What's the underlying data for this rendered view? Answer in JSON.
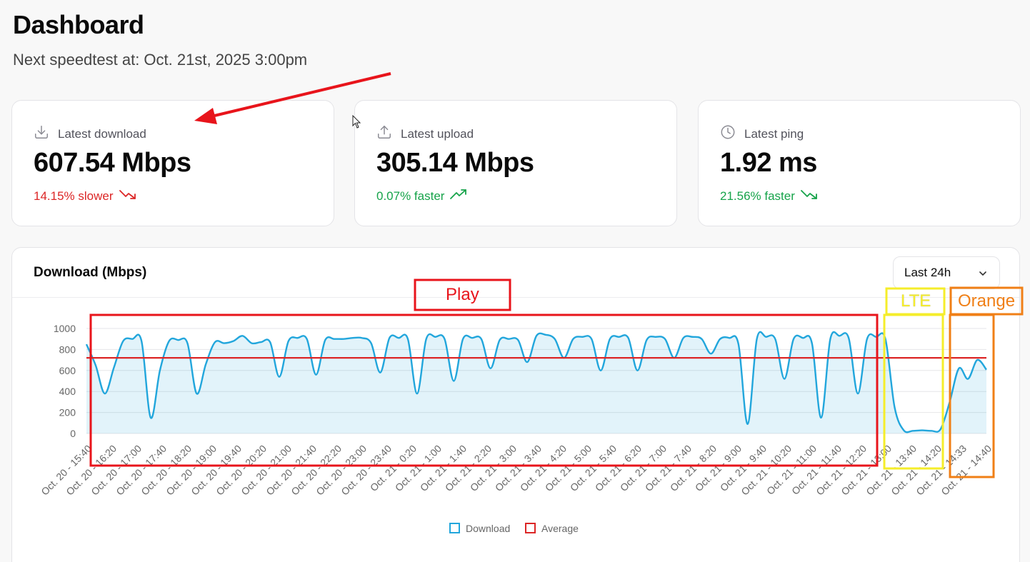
{
  "header": {
    "title": "Dashboard",
    "subtitle": "Next speedtest at: Oct. 21st, 2025 3:00pm"
  },
  "cards": [
    {
      "label": "Latest download",
      "icon": "download-icon",
      "value": "607.54 Mbps",
      "delta": "14.15% slower",
      "delta_color": "#dc2626",
      "trend": "down"
    },
    {
      "label": "Latest upload",
      "icon": "upload-icon",
      "value": "305.14 Mbps",
      "delta": "0.07% faster",
      "delta_color": "#16a34a",
      "trend": "up"
    },
    {
      "label": "Latest ping",
      "icon": "clock-icon",
      "value": "1.92 ms",
      "delta": "21.56% faster",
      "delta_color": "#16a34a",
      "trend": "down"
    }
  ],
  "chart_panel": {
    "title": "Download (Mbps)",
    "range_select": "Last 24h"
  },
  "annotations": {
    "play": "Play",
    "lte": "LTE",
    "orange": "Orange"
  },
  "chart_data": {
    "type": "area",
    "series": [
      {
        "name": "Download",
        "color": "#22a6dc",
        "values": [
          850,
          650,
          380,
          630,
          880,
          900,
          880,
          150,
          600,
          880,
          890,
          860,
          380,
          660,
          870,
          860,
          880,
          930,
          860,
          870,
          870,
          540,
          880,
          910,
          900,
          560,
          890,
          900,
          900,
          910,
          910,
          860,
          580,
          910,
          910,
          900,
          380,
          900,
          920,
          900,
          500,
          900,
          910,
          900,
          620,
          890,
          900,
          890,
          680,
          930,
          940,
          900,
          720,
          900,
          920,
          900,
          600,
          900,
          920,
          910,
          600,
          890,
          920,
          900,
          720,
          910,
          920,
          900,
          760,
          900,
          910,
          850,
          90,
          900,
          920,
          900,
          520,
          900,
          910,
          860,
          150,
          900,
          930,
          910,
          380,
          900,
          920,
          900,
          250,
          30,
          25,
          30,
          25,
          40,
          300,
          620,
          520,
          700,
          607.54
        ]
      },
      {
        "name": "Average",
        "color": "#dc2626",
        "values": [
          720
        ]
      }
    ],
    "x_tick_labels": [
      "Oct. 20 - 15:40",
      "Oct. 20 - 16:20",
      "Oct. 20 - 17:00",
      "Oct. 20 - 17:40",
      "Oct. 20 - 18:20",
      "Oct. 20 - 19:00",
      "Oct. 20 - 19:40",
      "Oct. 20 - 20:20",
      "Oct. 20 - 21:00",
      "Oct. 20 - 21:40",
      "Oct. 20 - 22:20",
      "Oct. 20 - 23:00",
      "Oct. 20 - 23:40",
      "Oct. 21 - 0:20",
      "Oct. 21 - 1:00",
      "Oct. 21 - 1:40",
      "Oct. 21 - 2:20",
      "Oct. 21 - 3:00",
      "Oct. 21 - 3:40",
      "Oct. 21 - 4:20",
      "Oct. 21 - 5:00",
      "Oct. 21 - 5:40",
      "Oct. 21 - 6:20",
      "Oct. 21 - 7:00",
      "Oct. 21 - 7:40",
      "Oct. 21 - 8:20",
      "Oct. 21 - 9:00",
      "Oct. 21 - 9:40",
      "Oct. 21 - 10:20",
      "Oct. 21 - 11:00",
      "Oct. 21 - 11:40",
      "Oct. 21 - 12:20",
      "Oct. 21 - 13:00",
      "Oct. 21 - 13:40",
      "Oct. 21 - 14:20",
      "Oct. 21 - 14:33",
      "Oct. 21 - 14:40"
    ],
    "y_ticks": [
      0,
      200,
      400,
      600,
      800,
      1000
    ],
    "ylim": [
      0,
      1000
    ],
    "grid": true,
    "legend": [
      "Download",
      "Average"
    ],
    "legend_position": "bottom"
  }
}
